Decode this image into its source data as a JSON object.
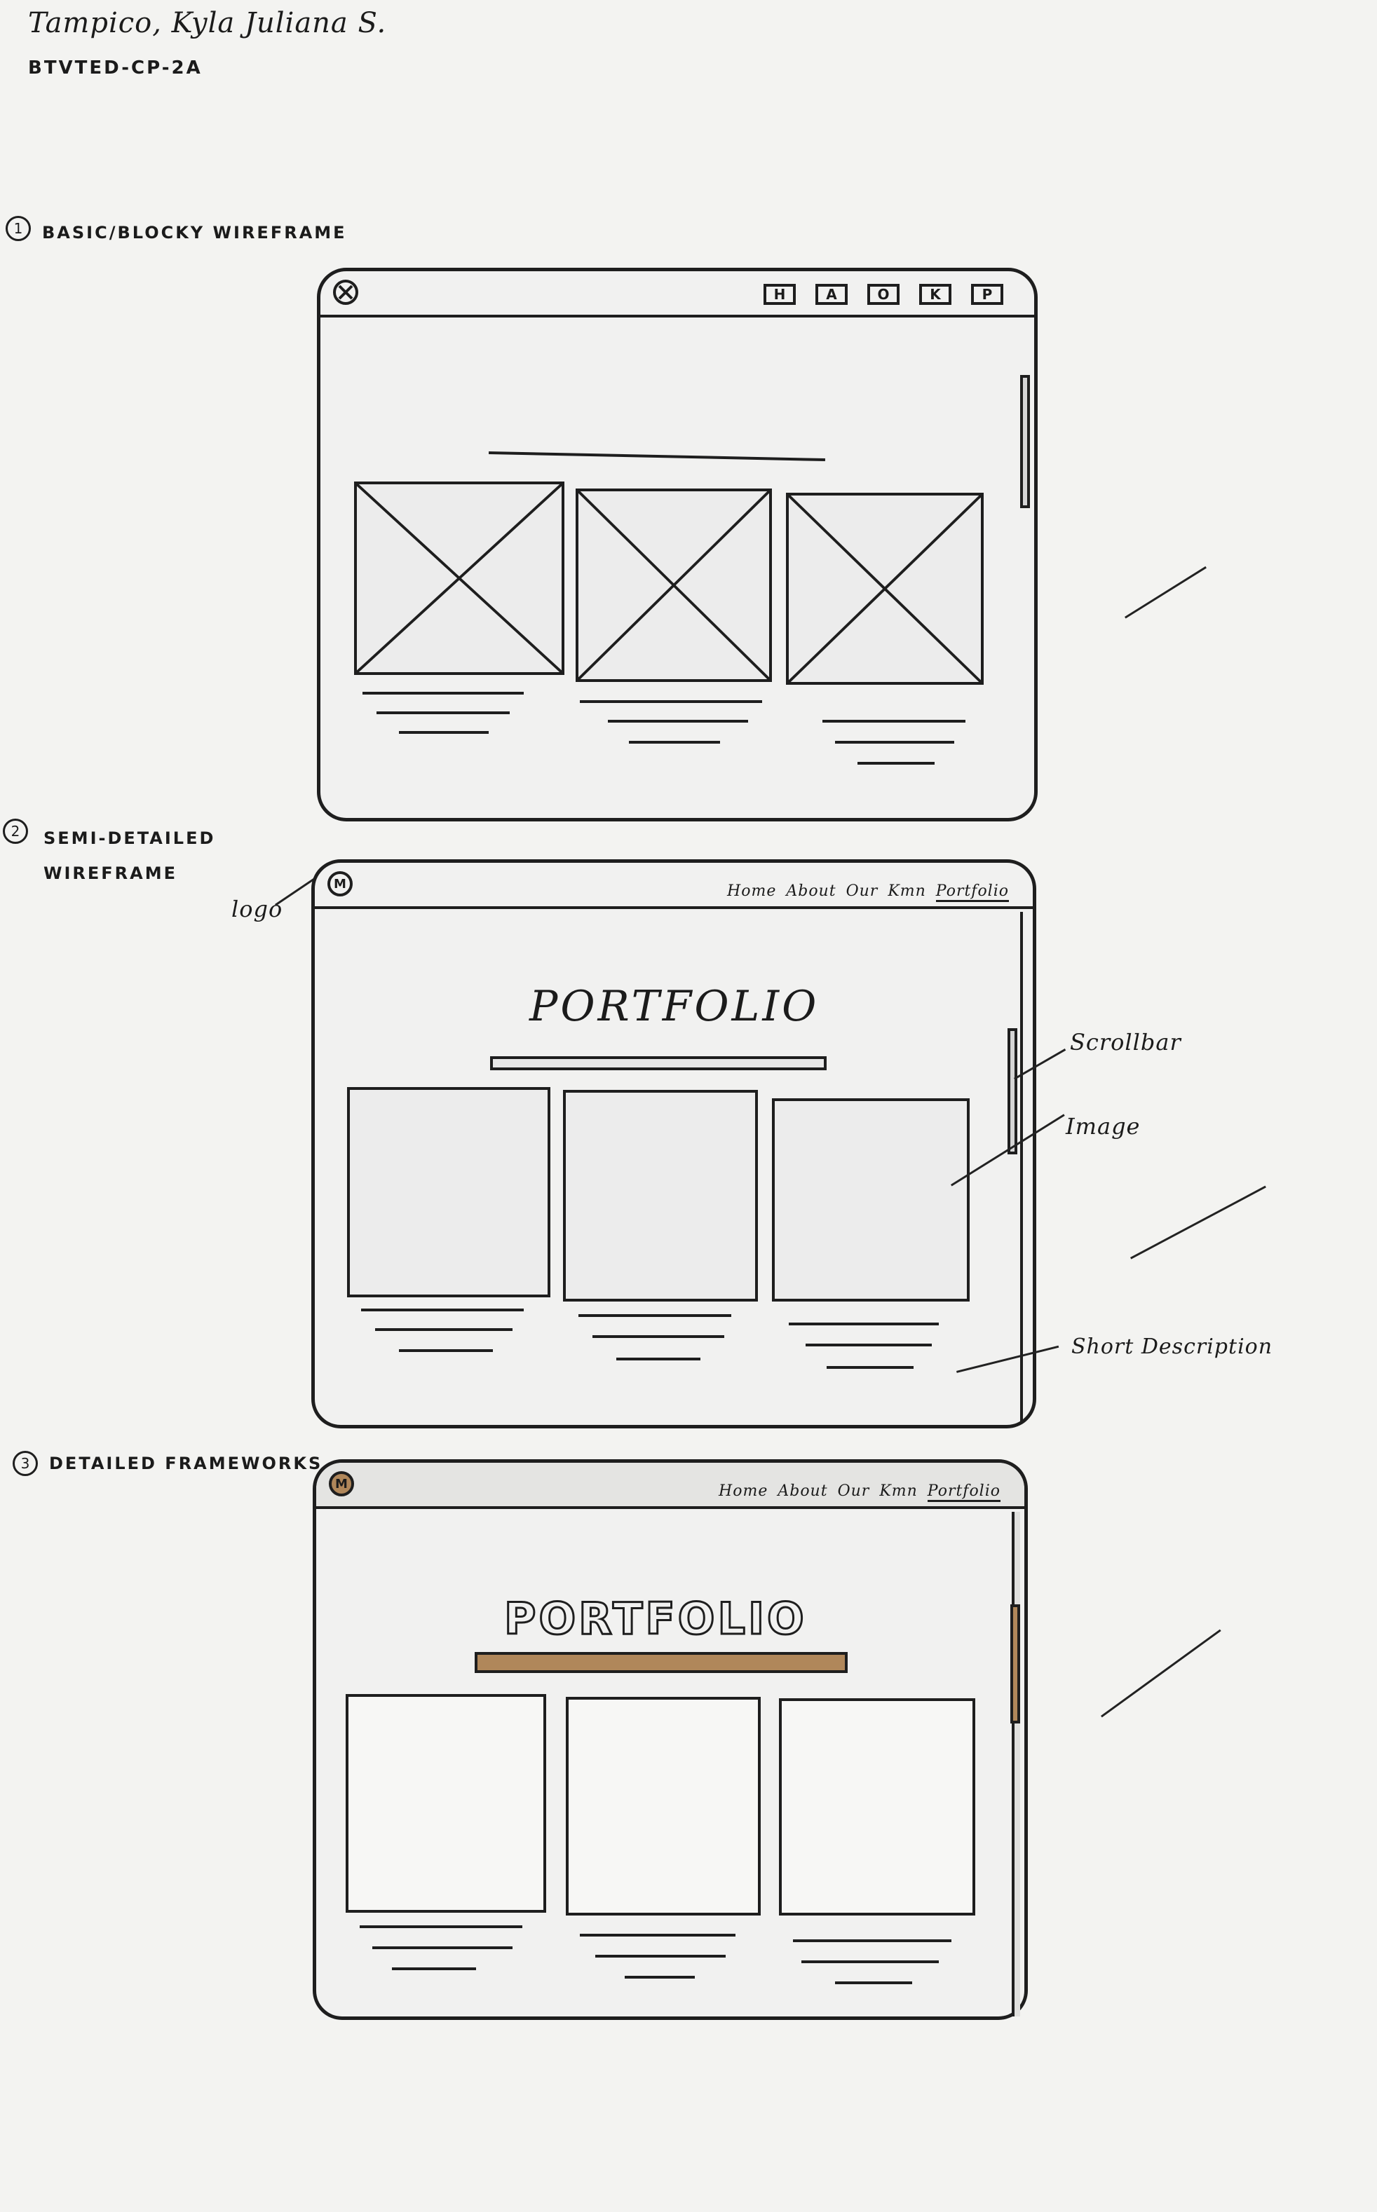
{
  "header": {
    "name": "Tampico, Kyla Juliana S.",
    "section": "BTVTED-CP-2A"
  },
  "sections": [
    {
      "number": "1",
      "title": "BASIC/BLOCKY WIREFRAME"
    },
    {
      "number": "2",
      "title_line1": "SEMI-DETAILED",
      "title_line2": "WIREFRAME"
    },
    {
      "number": "3",
      "title": "DETAILED FRAMEWORKS"
    }
  ],
  "wireframe1": {
    "nav_boxes": [
      "H",
      "A",
      "O",
      "K",
      "P"
    ]
  },
  "nav_links": [
    "Home",
    "About",
    "Our",
    "Kmn",
    "Portfolio"
  ],
  "logo_glyph": "M",
  "page_title": "PORTFOLIO",
  "annotations": {
    "logo": "logo",
    "scrollbar": "Scrollbar",
    "image": "Image",
    "short_description": "Short Description"
  },
  "colors": {
    "accent": "#b0875a",
    "ink": "#1e1e1e"
  },
  "icons": {
    "close": "close-icon",
    "image_placeholder": "image-placeholder-icon"
  }
}
